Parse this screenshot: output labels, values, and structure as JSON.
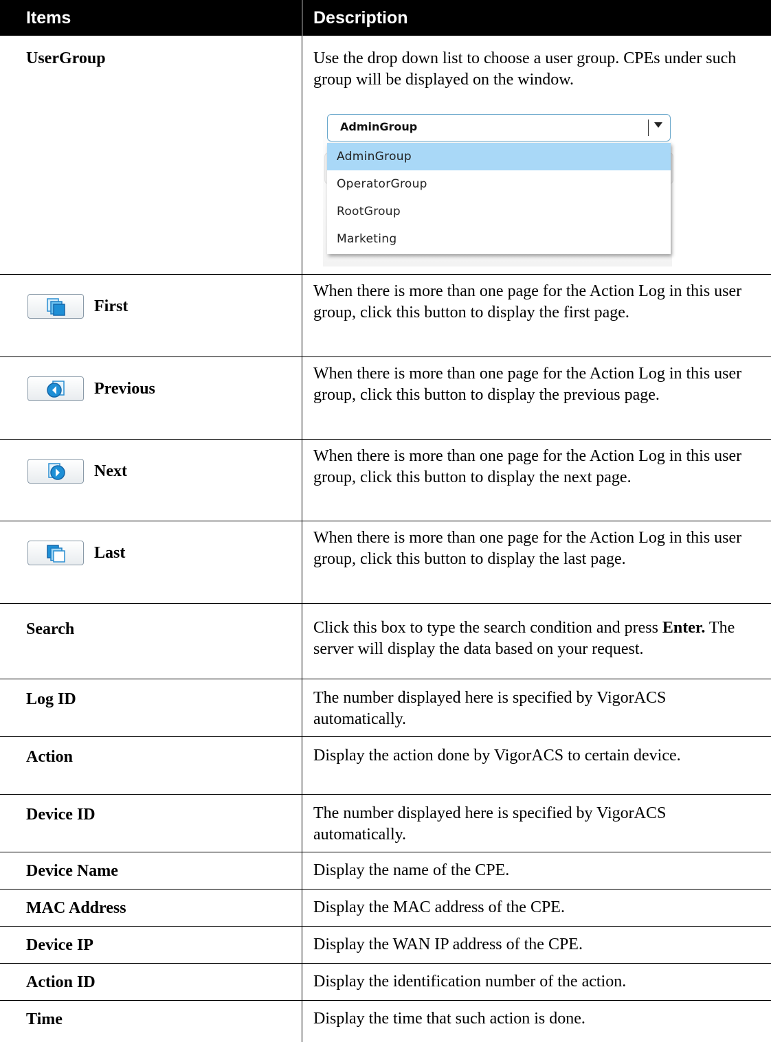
{
  "header": {
    "items": "Items",
    "description": "Description"
  },
  "usergroup": {
    "item": "UserGroup",
    "desc": "Use the drop down list to choose a user group. CPEs under such group will be displayed on the window.",
    "dropdown": {
      "selected": "AdminGroup",
      "options": [
        "AdminGroup",
        "OperatorGroup",
        "RootGroup",
        "Marketing"
      ]
    }
  },
  "first": {
    "label": "First",
    "icon": "first-page-icon",
    "desc": "When there is more than one page for the Action Log in this user group, click this button to display the first page."
  },
  "previous": {
    "label": "Previous",
    "icon": "previous-page-icon",
    "desc": "When there is more than one page for the Action Log in this user group, click this button to display the previous page."
  },
  "next": {
    "label": "Next",
    "icon": "next-page-icon",
    "desc": "When there is more than one page for the Action Log in this user group, click this button to display the next page."
  },
  "last": {
    "label": "Last",
    "icon": "last-page-icon",
    "desc": "When there is more than one page for the Action Log in this user group, click this button to display the last page."
  },
  "search": {
    "item": "Search",
    "desc_pre": "Click this box to type the search condition and press ",
    "desc_bold": "Enter.",
    "desc_post": " The server will display the data based on your request."
  },
  "rows": [
    {
      "item": "Log ID",
      "desc": "The number displayed here is specified by VigorACS automatically."
    },
    {
      "item": "Action",
      "desc": "Display the action done by VigorACS to certain device."
    },
    {
      "item": "Device ID",
      "desc": "The number displayed here is specified by VigorACS automatically."
    },
    {
      "item": "Device Name",
      "desc": "Display the name of the CPE."
    },
    {
      "item": "MAC Address",
      "desc": "Display the MAC address of the CPE."
    },
    {
      "item": "Device IP",
      "desc": "Display the WAN IP address of the CPE."
    },
    {
      "item": "Action ID",
      "desc": "Display the identification number of the action."
    },
    {
      "item": "Time",
      "desc": "Display the time that such action is done."
    }
  ],
  "colors": {
    "header_bg": "#000000",
    "selected_option": "#a9d8f7",
    "button_icon": "#1e8fd6"
  }
}
